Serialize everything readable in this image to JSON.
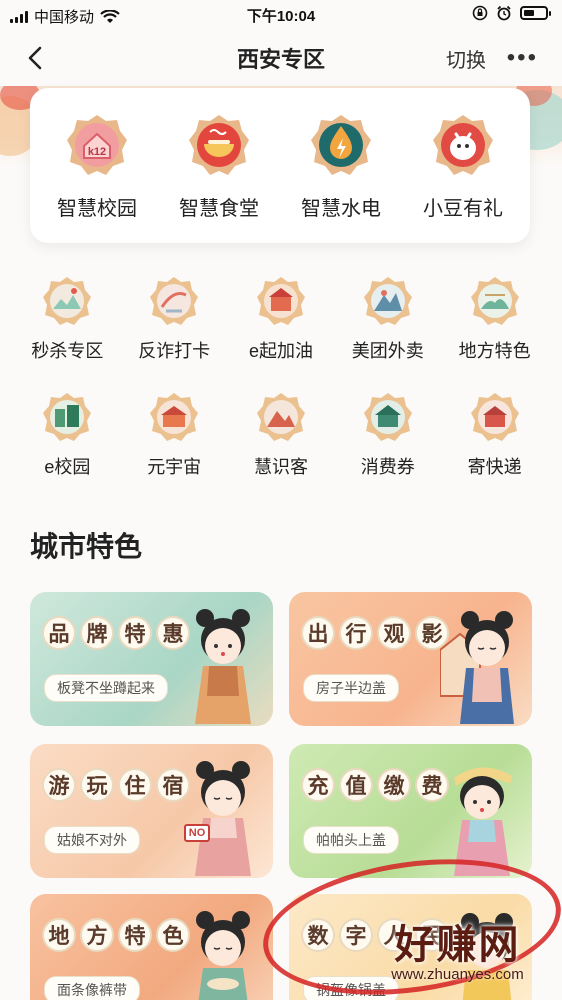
{
  "status_bar": {
    "carrier": "中国移动",
    "time": "下午10:04"
  },
  "nav": {
    "title": "西安专区",
    "switch_label": "切换",
    "more_label": "•••"
  },
  "top_services": [
    {
      "label": "智慧校园",
      "icon": "k12-school-icon",
      "badge": "k12"
    },
    {
      "label": "智慧食堂",
      "icon": "canteen-bowl-icon"
    },
    {
      "label": "智慧水电",
      "icon": "water-electric-icon"
    },
    {
      "label": "小豆有礼",
      "icon": "mascot-gift-icon"
    }
  ],
  "grid_services": [
    {
      "label": "秒杀专区",
      "icon": "flash-sale-icon"
    },
    {
      "label": "反诈打卡",
      "icon": "anti-fraud-icon"
    },
    {
      "label": "e起加油",
      "icon": "fuel-icon"
    },
    {
      "label": "美团外卖",
      "icon": "takeout-icon"
    },
    {
      "label": "地方特色",
      "icon": "local-special-icon"
    },
    {
      "label": "e校园",
      "icon": "campus-icon"
    },
    {
      "label": "元宇宙",
      "icon": "metaverse-icon"
    },
    {
      "label": "慧识客",
      "icon": "smart-guest-icon"
    },
    {
      "label": "消费券",
      "icon": "coupon-icon"
    },
    {
      "label": "寄快递",
      "icon": "express-icon"
    }
  ],
  "section_title": "城市特色",
  "feature_cards": [
    {
      "title": "品牌特惠",
      "subtitle": "板凳不坐蹲起来"
    },
    {
      "title": "出行观影",
      "subtitle": "房子半边盖"
    },
    {
      "title": "游玩住宿",
      "subtitle": "姑娘不对外",
      "sign": "NO"
    },
    {
      "title": "充值缴费",
      "subtitle": "帕帕头上盖"
    },
    {
      "title": "地方特色",
      "subtitle": "面条像裤带"
    },
    {
      "title": "数字人民币",
      "subtitle": "锅盔像锅盖"
    }
  ],
  "watermark": {
    "text": "好赚网",
    "url": "www.zhuanyes.com"
  },
  "colors": {
    "accent_red": "#d32222",
    "text_dark": "#222222"
  }
}
